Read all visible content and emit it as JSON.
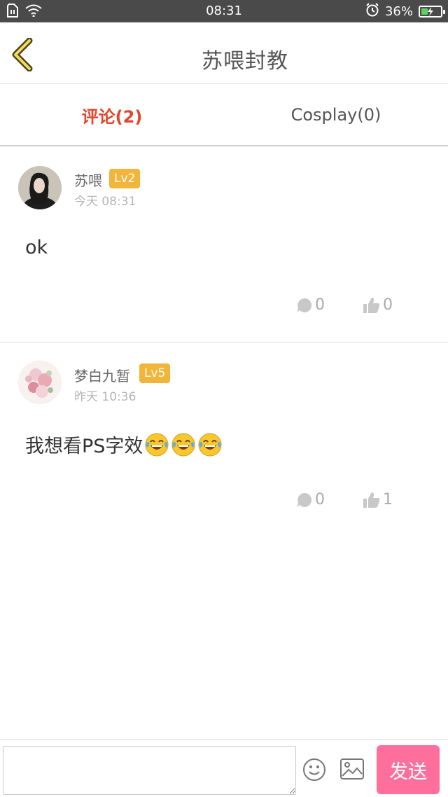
{
  "status_bar": {
    "time": "08:31",
    "battery_percent": "36%",
    "battery_level": 0.36,
    "icons": [
      "sim-icon",
      "wifi-icon",
      "alarm-icon",
      "battery-icon"
    ]
  },
  "header": {
    "title": "苏喂封教",
    "back_icon": "chevron-left-icon"
  },
  "tabs": [
    {
      "label": "评论(2)",
      "active": true
    },
    {
      "label": "Cosplay(0)",
      "active": false
    }
  ],
  "comments": [
    {
      "username": "苏喂",
      "level": "Lv2",
      "time": "今天 08:31",
      "text": "ok",
      "emoji_count": 0,
      "reply_count": "0",
      "like_count": "0"
    },
    {
      "username": "梦白九暂",
      "level": "Lv5",
      "time": "昨天 10:36",
      "text": "我想看PS字效",
      "emoji_count": 3,
      "reply_count": "0",
      "like_count": "1"
    }
  ],
  "bottom_bar": {
    "input_value": "",
    "send_label": "发送"
  },
  "colors": {
    "accent": "#e2462b",
    "send_button": "#fe6f9d",
    "level_badge": "#f2b53a",
    "status_bar": "#4a4a4a"
  }
}
